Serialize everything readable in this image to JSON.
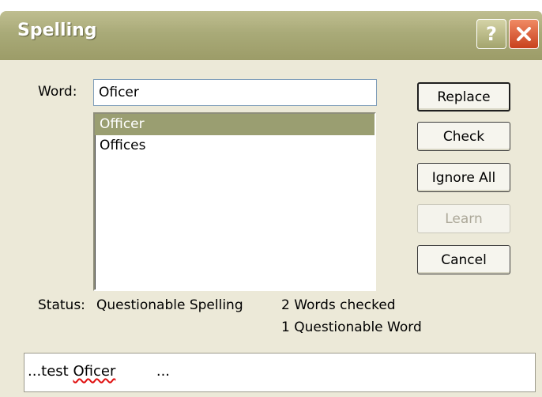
{
  "dialog": {
    "title": "Spelling",
    "help_glyph": "?",
    "word_label": "Word:",
    "word_value": "Oficer"
  },
  "suggestions": [
    {
      "text": "Officer",
      "selected": true
    },
    {
      "text": "Offices",
      "selected": false
    }
  ],
  "buttons": {
    "replace": "Replace",
    "check": "Check",
    "ignore_all": "Ignore All",
    "learn": "Learn",
    "cancel": "Cancel"
  },
  "status": {
    "label": "Status:",
    "value": "Questionable Spelling",
    "words_checked": "2 Words checked",
    "questionable_count": "1 Questionable Word"
  },
  "context": {
    "prefix": "...test ",
    "word": "Oficer",
    "suffix": "         ..."
  },
  "colors": {
    "titlebar": "#a9aa78",
    "selection": "#9a9e71",
    "dialog_bg": "#ece9d8",
    "close_button": "#d9532c"
  },
  "icons": {
    "help": "help-icon",
    "close": "close-icon"
  }
}
